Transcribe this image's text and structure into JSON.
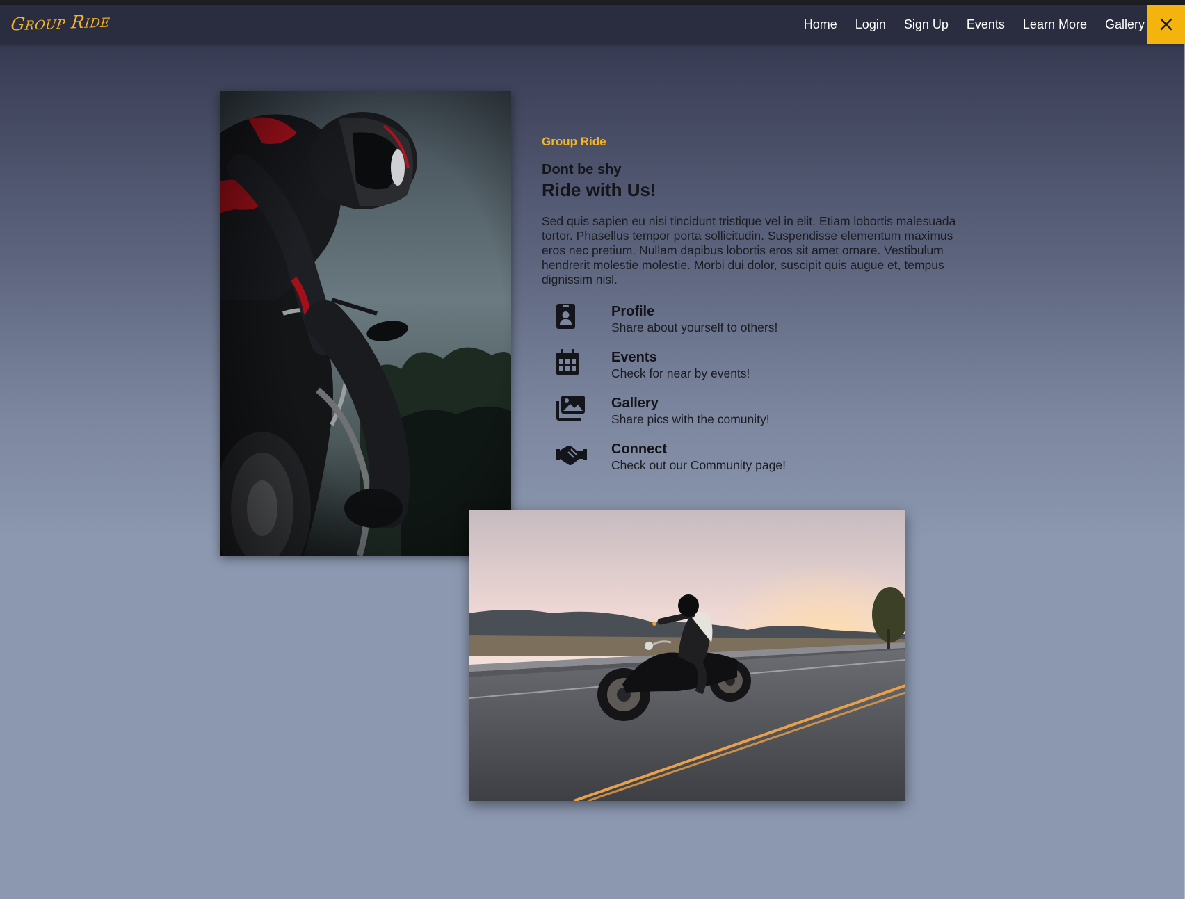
{
  "nav": {
    "brand": "Group Ride",
    "links": [
      "Home",
      "Login",
      "Sign Up",
      "Events",
      "Learn More",
      "Gallery"
    ],
    "close_icon": "close-icon"
  },
  "colors": {
    "accent": "#f5b325",
    "navbar_bg": "#2a2c40",
    "text": "#14151a"
  },
  "hero": {
    "eyebrow": "Group Ride",
    "subheading": "Dont be shy",
    "heading": "Ride with Us!",
    "body": "Sed quis sapien eu nisi tincidunt tristique vel in elit. Etiam lobortis malesuada tortor. Phasellus tempor porta sollicitudin. Suspendisse elementum maximus eros nec pretium. Nullam dapibus lobortis eros sit amet ornare. Vestibulum hendrerit molestie molestie. Morbi dui dolor, suscipit quis augue et, tempus dignissim nisl."
  },
  "features": [
    {
      "icon": "id-badge-icon",
      "title": "Profile",
      "desc": "Share about yourself to others!"
    },
    {
      "icon": "calendar-icon",
      "title": "Events",
      "desc": "Check for near by events!"
    },
    {
      "icon": "images-icon",
      "title": "Gallery",
      "desc": "Share pics with the comunity!"
    },
    {
      "icon": "handshake-icon",
      "title": "Connect",
      "desc": "Check out our Community page!"
    }
  ]
}
